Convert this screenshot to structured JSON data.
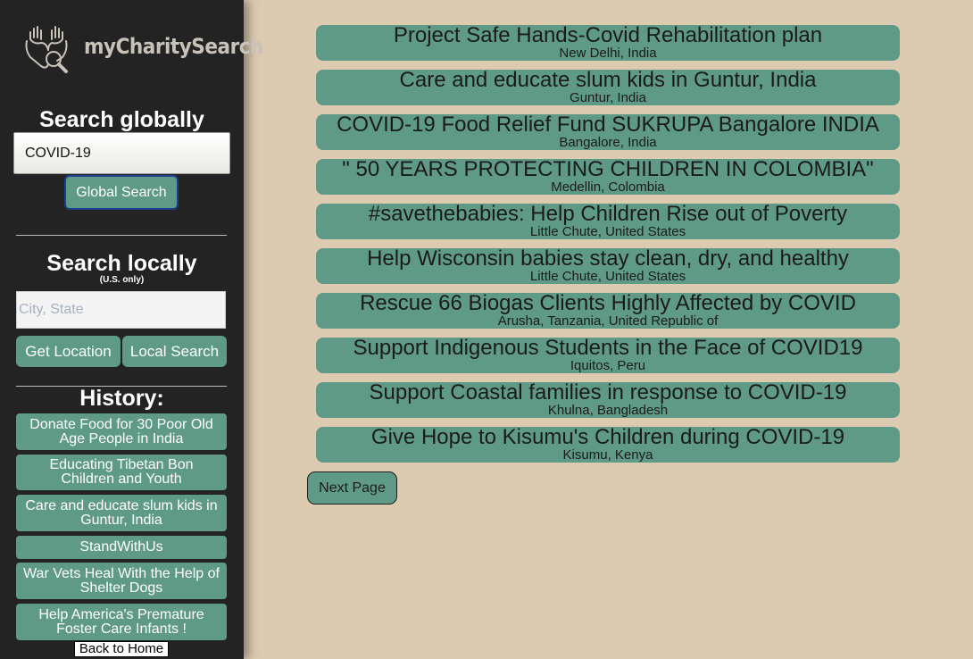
{
  "sidebar": {
    "logo_text": "myCharitySearch",
    "search_globally_heading": "Search globally",
    "global_search_value": "COVID-19",
    "global_search_button": "Global Search",
    "search_locally_heading": "Search locally",
    "search_locally_note": "(U.S. only)",
    "local_search_placeholder": "City, State",
    "get_location_button": "Get Location",
    "local_search_button": "Local Search",
    "history_heading": "History:",
    "history": [
      "Donate Food for 30 Poor Old Age People in India",
      "Educating Tibetan Bon Children and Youth",
      "Care and educate slum kids in Guntur, India",
      "StandWithUs",
      "War Vets Heal With the Help of Shelter Dogs",
      "Help America's Premature Foster Care Infants !"
    ],
    "back_to_home": "Back to Home"
  },
  "results": [
    {
      "title": "Project Safe Hands-Covid Rehabilitation plan",
      "location": "New Delhi, India"
    },
    {
      "title": "Care and educate slum kids in Guntur, India",
      "location": "Guntur, India"
    },
    {
      "title": "COVID-19 Food Relief Fund SUKRUPA Bangalore INDIA",
      "location": "Bangalore, India"
    },
    {
      "title": "\" 50 YEARS PROTECTING CHILDREN IN COLOMBIA\"",
      "location": "Medellin, Colombia"
    },
    {
      "title": "#savethebabies: Help Children Rise out of Poverty",
      "location": "Little Chute, United States"
    },
    {
      "title": "Help Wisconsin babies stay clean, dry, and healthy",
      "location": "Little Chute, United States"
    },
    {
      "title": "Rescue 66 Biogas Clients Highly Affected by COVID",
      "location": "Arusha, Tanzania, United Republic of"
    },
    {
      "title": "Support Indigenous Students in the Face of COVID19",
      "location": "Iquitos, Peru"
    },
    {
      "title": "Support Coastal families in response to COVID-19",
      "location": "Khulna, Bangladesh"
    },
    {
      "title": "Give Hope to Kisumu's Children during COVID-19",
      "location": "Kisumu, Kenya"
    }
  ],
  "next_page_button": "Next Page",
  "colors": {
    "background": "#dccbb0",
    "sidebar": "#232323",
    "accent_green": "#5e9a85",
    "logo_text": "#c8c2b8"
  },
  "icons": [
    "hands-magnifier-logo-icon"
  ]
}
